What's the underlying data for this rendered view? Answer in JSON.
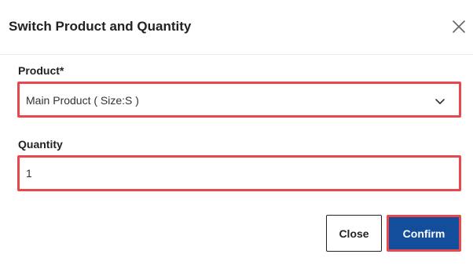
{
  "dialog": {
    "title": "Switch Product and Quantity",
    "close_icon": "close-x-icon"
  },
  "product": {
    "label": "Product*",
    "selected_value": "Main Product ( Size:S )",
    "dropdown_icon": "chevron-down-icon"
  },
  "quantity": {
    "label": "Quantity",
    "value": "1"
  },
  "buttons": {
    "close_label": "Close",
    "confirm_label": "Confirm"
  },
  "colors": {
    "highlight_border": "#e8474b",
    "confirm_bg": "#124e9b",
    "text": "#222222"
  }
}
